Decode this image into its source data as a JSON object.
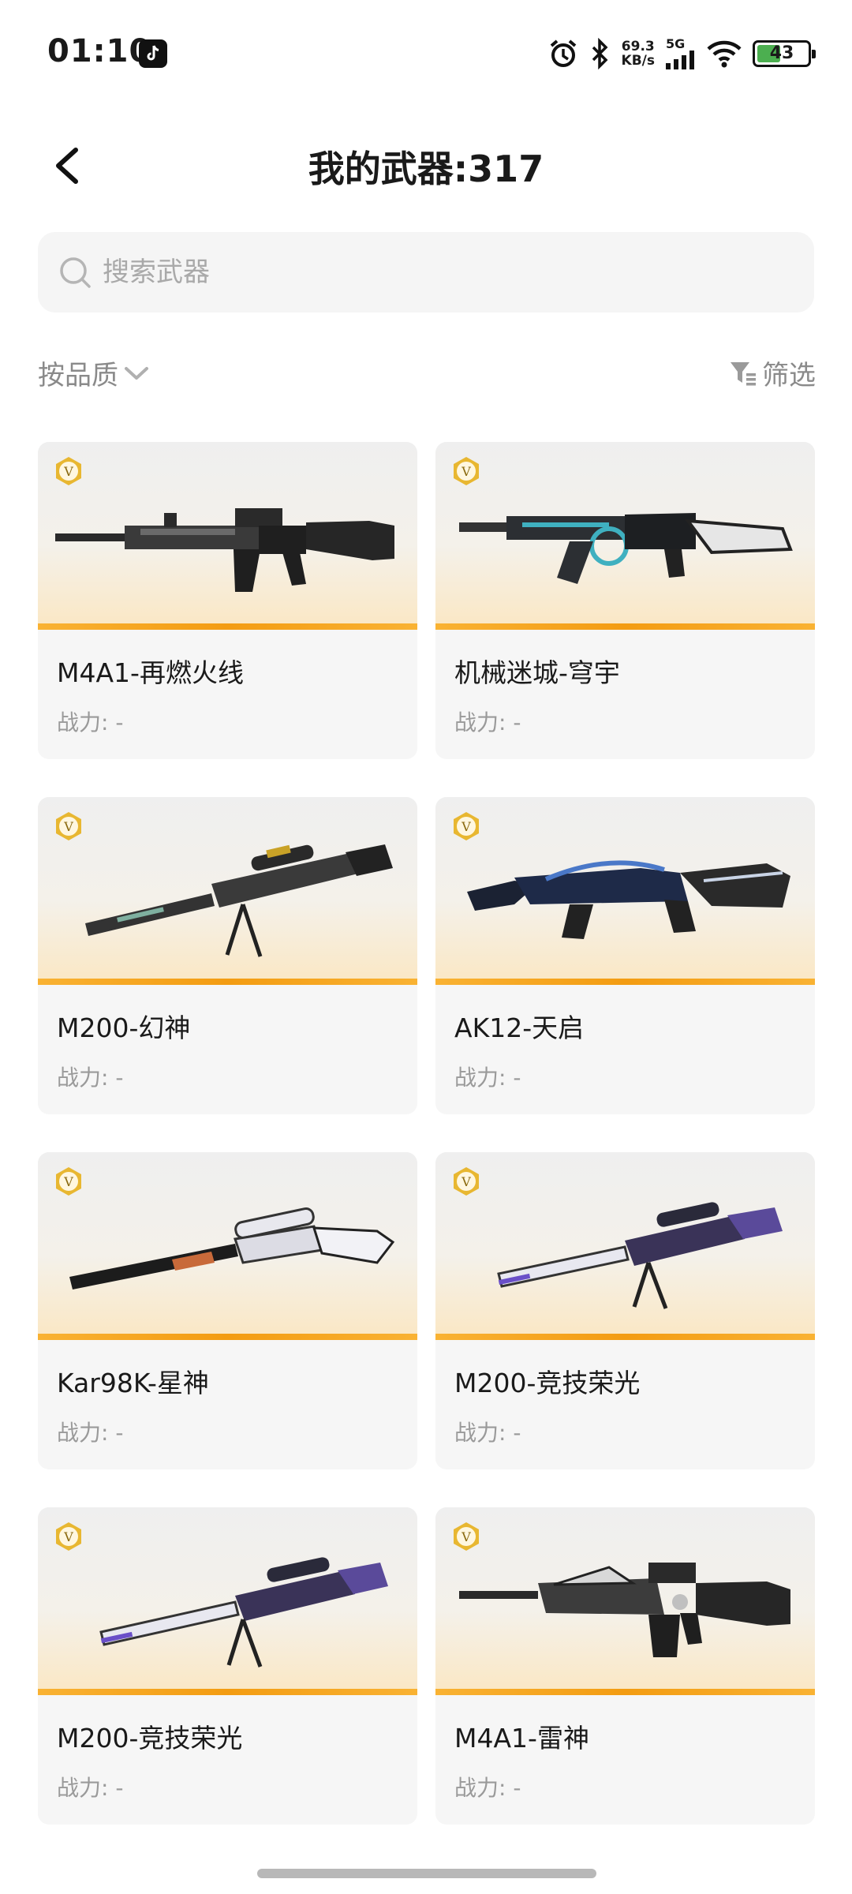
{
  "status": {
    "time": "01:10",
    "net_speed": "69.3",
    "net_unit": "KB/s",
    "signal_type": "5G",
    "battery": "43"
  },
  "header": {
    "title": "我的武器:317"
  },
  "search": {
    "placeholder": "搜索武器"
  },
  "toolbar": {
    "sort_label": "按品质",
    "filter_label": "筛选"
  },
  "colors": {
    "accent": "#f39c12",
    "card_bg": "#f6f6f6"
  },
  "weapons": [
    {
      "name": "M4A1-再燃火线",
      "power_label": "战力: -",
      "icon": "rifle-dark"
    },
    {
      "name": "机械迷城-穹宇",
      "power_label": "战力: -",
      "icon": "rifle-teal"
    },
    {
      "name": "M200-幻神",
      "power_label": "战力: -",
      "icon": "sniper-gold"
    },
    {
      "name": "AK12-天启",
      "power_label": "战力: -",
      "icon": "rifle-blue"
    },
    {
      "name": "Kar98K-星神",
      "power_label": "战力: -",
      "icon": "sniper-white"
    },
    {
      "name": "M200-竞技荣光",
      "power_label": "战力: -",
      "icon": "sniper-purple"
    },
    {
      "name": "M200-竞技荣光",
      "power_label": "战力: -",
      "icon": "sniper-purple"
    },
    {
      "name": "M4A1-雷神",
      "power_label": "战力: -",
      "icon": "rifle-silver"
    }
  ]
}
